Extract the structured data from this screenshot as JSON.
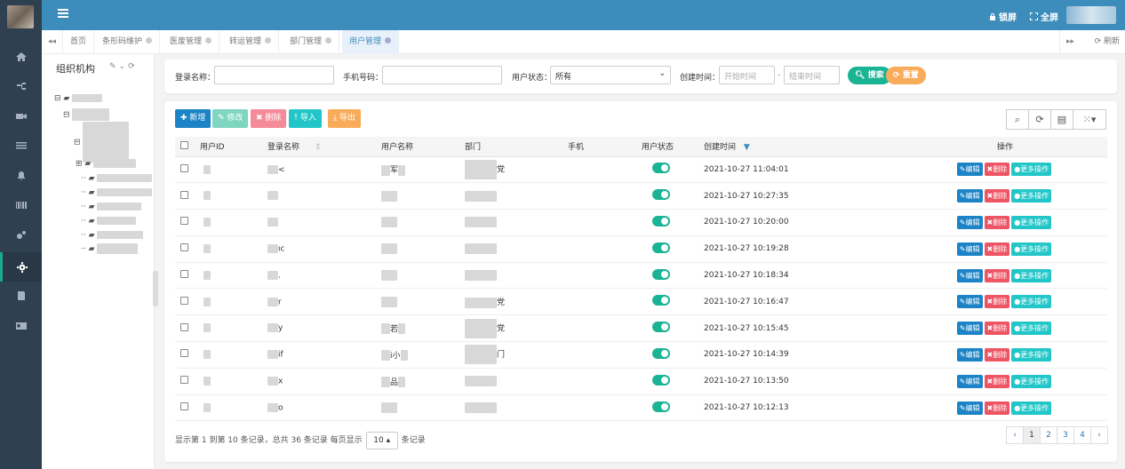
{
  "topbar": {
    "lock_label": "锁屏",
    "fullscreen_label": "全屏"
  },
  "nav": {
    "icons": [
      "home-icon",
      "sitemap-icon",
      "video-icon",
      "list-icon",
      "bell-icon",
      "barcode-icon",
      "cogs-icon",
      "gear-icon",
      "book-icon",
      "id-card-icon"
    ],
    "active_index": 7
  },
  "tabs": {
    "items": [
      "首页",
      "条形码维护",
      "医废管理",
      "转运管理",
      "部门管理",
      "用户管理"
    ],
    "active": "用户管理",
    "refresh_label": "刷新"
  },
  "org": {
    "title": "组织机构"
  },
  "search": {
    "login_name_label": "登录名称：",
    "phone_label": "手机号码：",
    "status_label": "用户状态：",
    "status_value": "所有",
    "created_label": "创建时间：",
    "start_placeholder": "开始时间",
    "end_placeholder": "结束时间",
    "dash": "-",
    "search_btn": "搜索",
    "reset_btn": "重置"
  },
  "toolbar": {
    "add": "新增",
    "edit": "修改",
    "delete": "删除",
    "import": "导入",
    "export": "导出"
  },
  "table": {
    "headers": [
      "用户ID",
      "登录名称",
      "用户名称",
      "部门",
      "手机",
      "用户状态",
      "创建时间",
      "操作"
    ],
    "rows": [
      {
        "created": "2021-10-27 11:04:01",
        "login_tail": "<",
        "name_tail": "军",
        "dept_tail": "党"
      },
      {
        "created": "2021-10-27 10:27:35",
        "login_tail": "",
        "name_tail": "",
        "dept_tail": ""
      },
      {
        "created": "2021-10-27 10:20:00",
        "login_tail": "",
        "name_tail": "",
        "dept_tail": ""
      },
      {
        "created": "2021-10-27 10:19:28",
        "login_tail": "ıc",
        "name_tail": "",
        "dept_tail": ""
      },
      {
        "created": "2021-10-27 10:18:34",
        "login_tail": ".",
        "name_tail": "",
        "dept_tail": ""
      },
      {
        "created": "2021-10-27 10:16:47",
        "login_tail": "r",
        "name_tail": "",
        "dept_tail": "党"
      },
      {
        "created": "2021-10-27 10:15:45",
        "login_tail": "y",
        "name_tail": "若",
        "dept_tail": "党"
      },
      {
        "created": "2021-10-27 10:14:39",
        "login_tail": "if",
        "name_tail": "i小",
        "dept_tail": "门"
      },
      {
        "created": "2021-10-27 10:13:50",
        "login_tail": "x",
        "name_tail": "品",
        "dept_tail": ""
      },
      {
        "created": "2021-10-27 10:12:13",
        "login_tail": "o",
        "name_tail": "",
        "dept_tail": ""
      }
    ],
    "actions": {
      "edit": "编辑",
      "delete": "删除",
      "more": "更多操作"
    }
  },
  "pager": {
    "info": "显示第 1 到第 10 条记录，总共 36 条记录  每页显示",
    "page_size": "10",
    "suffix": "条记录",
    "pages": [
      "‹",
      "1",
      "2",
      "3",
      "4",
      "›"
    ],
    "current": "1"
  },
  "colors": {
    "topbar": "#3c8dbc",
    "sidebar": "#2f4050",
    "toggle_on": "#1ab394",
    "search_btn": "#1ab394",
    "reset_btn": "#f8ac59",
    "add_btn": "#1c84c6",
    "edit_btn": "#7fd6c0",
    "delete_btn": "#f48b98",
    "import_btn": "#23c6c8",
    "export_btn": "#f8ac59"
  }
}
